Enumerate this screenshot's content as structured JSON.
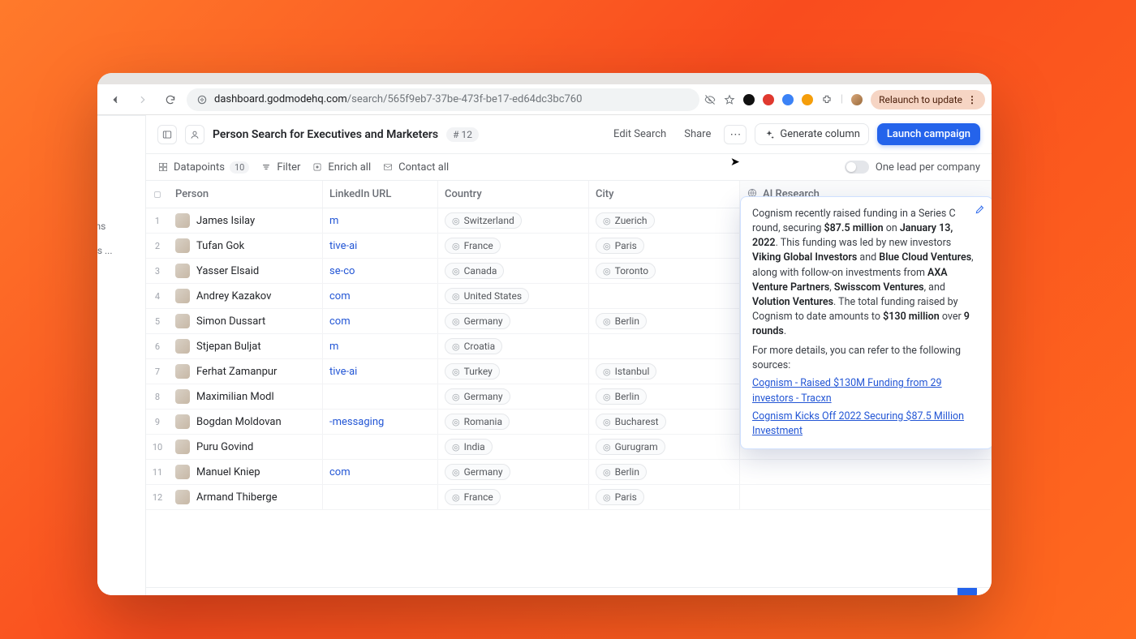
{
  "browser": {
    "url_host": "dashboard.godmodehq.com",
    "url_rest": "/search/565f9eb7-37be-473f-be17-ed64dc3bc760",
    "relaunch_label": "Relaunch to update"
  },
  "sidebar": {
    "item1": "npaigns",
    "item2": "cutives ..."
  },
  "header": {
    "title": "Person Search for Executives and Marketers",
    "count": "# 12",
    "edit": "Edit Search",
    "share": "Share",
    "generate": "Generate column",
    "launch": "Launch campaign"
  },
  "toolbar": {
    "datapoints": "Datapoints",
    "datapoints_count": "10",
    "filter": "Filter",
    "enrich": "Enrich all",
    "contact": "Contact all",
    "one_lead": "One lead per company"
  },
  "columns": {
    "person": "Person",
    "linkedin": "LinkedIn URL",
    "country": "Country",
    "city": "City",
    "ai": "AI Research"
  },
  "rows": [
    {
      "idx": "1",
      "name": "James Isilay",
      "link": "m",
      "country": "Switzerland",
      "city": "Zuerich"
    },
    {
      "idx": "2",
      "name": "Tufan Gok",
      "link": "tive-ai",
      "country": "France",
      "city": "Paris"
    },
    {
      "idx": "3",
      "name": "Yasser Elsaid",
      "link": "se-co",
      "country": "Canada",
      "city": "Toronto"
    },
    {
      "idx": "4",
      "name": "Andrey Kazakov",
      "link": "com",
      "country": "United States",
      "city": ""
    },
    {
      "idx": "5",
      "name": "Simon Dussart",
      "link": "com",
      "country": "Germany",
      "city": "Berlin"
    },
    {
      "idx": "6",
      "name": "Stjepan Buljat",
      "link": "m",
      "country": "Croatia",
      "city": ""
    },
    {
      "idx": "7",
      "name": "Ferhat Zamanpur",
      "link": "tive-ai",
      "country": "Turkey",
      "city": "Istanbul"
    },
    {
      "idx": "8",
      "name": "Maximilian Modl",
      "link": "",
      "country": "Germany",
      "city": "Berlin"
    },
    {
      "idx": "9",
      "name": "Bogdan Moldovan",
      "link": "-messaging",
      "country": "Romania",
      "city": "Bucharest"
    },
    {
      "idx": "10",
      "name": "Puru Govind",
      "link": "",
      "country": "India",
      "city": "Gurugram"
    },
    {
      "idx": "11",
      "name": "Manuel Kniep",
      "link": "com",
      "country": "Germany",
      "city": "Berlin"
    },
    {
      "idx": "12",
      "name": "Armand Thiberge",
      "link": "",
      "country": "France",
      "city": "Paris"
    }
  ],
  "ai_research": {
    "t1": "Cognism recently raised funding in a Series C round, securing ",
    "b1": "$87.5 million",
    "t2": " on ",
    "b2": "January 13, 2022",
    "t3": ". This funding was led by new investors ",
    "b3": "Viking Global Investors",
    "t4": " and ",
    "b4": "Blue Cloud Ventures",
    "t5": ", along with follow-on investments from ",
    "b5": "AXA Venture Partners",
    "t6": ", ",
    "b6": "Swisscom Ventures",
    "t7": ", and ",
    "b7": "Volution Ventures",
    "t8": ". The total funding raised by Cognism to date amounts to ",
    "b8": "$130 million",
    "t9": " over ",
    "b9": "9 rounds",
    "t10": ".",
    "more": "For more details, you can refer to the following sources:",
    "src1": "Cognism - Raised $130M Funding from 29 investors - Tracxn",
    "src2": "Cognism Kicks Off 2022 Securing $87.5 Million Investment"
  }
}
